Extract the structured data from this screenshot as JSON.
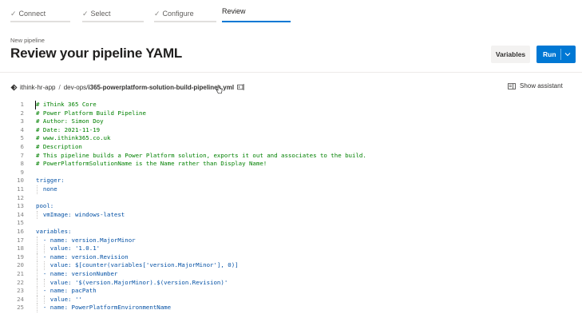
{
  "wizard": {
    "steps": [
      {
        "label": "Connect",
        "state": "done"
      },
      {
        "label": "Select",
        "state": "done"
      },
      {
        "label": "Configure",
        "state": "done"
      },
      {
        "label": "Review",
        "state": "active"
      }
    ]
  },
  "header": {
    "subtitle": "New pipeline",
    "title": "Review your pipeline YAML",
    "variables_label": "Variables",
    "run_label": "Run"
  },
  "path": {
    "repo": "ithink-hr-app",
    "separator": "/",
    "folder": "dev-ops/",
    "file": "i365-powerplatform-solution-build-pipelines.yml",
    "assistant_label": "Show assistant"
  },
  "colors": {
    "accent": "#0078d4",
    "comment": "#008000",
    "key": "#0451a5"
  },
  "code_lines": [
    {
      "n": "1",
      "text": "# iThink 365 Core"
    },
    {
      "n": "2",
      "text": "# Power Platform Build Pipeline"
    },
    {
      "n": "3",
      "text": "# Author: Simon Doy"
    },
    {
      "n": "4",
      "text": "# Date: 2021-11-19"
    },
    {
      "n": "5",
      "text": "# www.ithink365.co.uk"
    },
    {
      "n": "6",
      "text": "# Description"
    },
    {
      "n": "7",
      "text": "# This pipeline builds a Power Platform solution, exports it out and associates to the build."
    },
    {
      "n": "8",
      "text": "# PowerPlatformSolutionName is the Name rather than Display Name!"
    },
    {
      "n": "9",
      "text": ""
    },
    {
      "n": "10",
      "text": "trigger:"
    },
    {
      "n": "11",
      "text": "  none"
    },
    {
      "n": "12",
      "text": ""
    },
    {
      "n": "13",
      "text": "pool:"
    },
    {
      "n": "14",
      "text": "  vmImage: windows-latest"
    },
    {
      "n": "15",
      "text": ""
    },
    {
      "n": "16",
      "text": "variables:"
    },
    {
      "n": "17",
      "text": "  - name: version.MajorMinor"
    },
    {
      "n": "18",
      "text": "    value: '1.0.1'"
    },
    {
      "n": "19",
      "text": "  - name: version.Revision"
    },
    {
      "n": "20",
      "text": "    value: $[counter(variables['version.MajorMinor'], 0)]"
    },
    {
      "n": "21",
      "text": "  - name: versionNumber"
    },
    {
      "n": "22",
      "text": "    value: '$(version.MajorMinor).$(version.Revision)'"
    },
    {
      "n": "23",
      "text": "  - name: pacPath"
    },
    {
      "n": "24",
      "text": "    value: ''"
    },
    {
      "n": "25",
      "text": "  - name: PowerPlatformEnvironmentName"
    }
  ]
}
